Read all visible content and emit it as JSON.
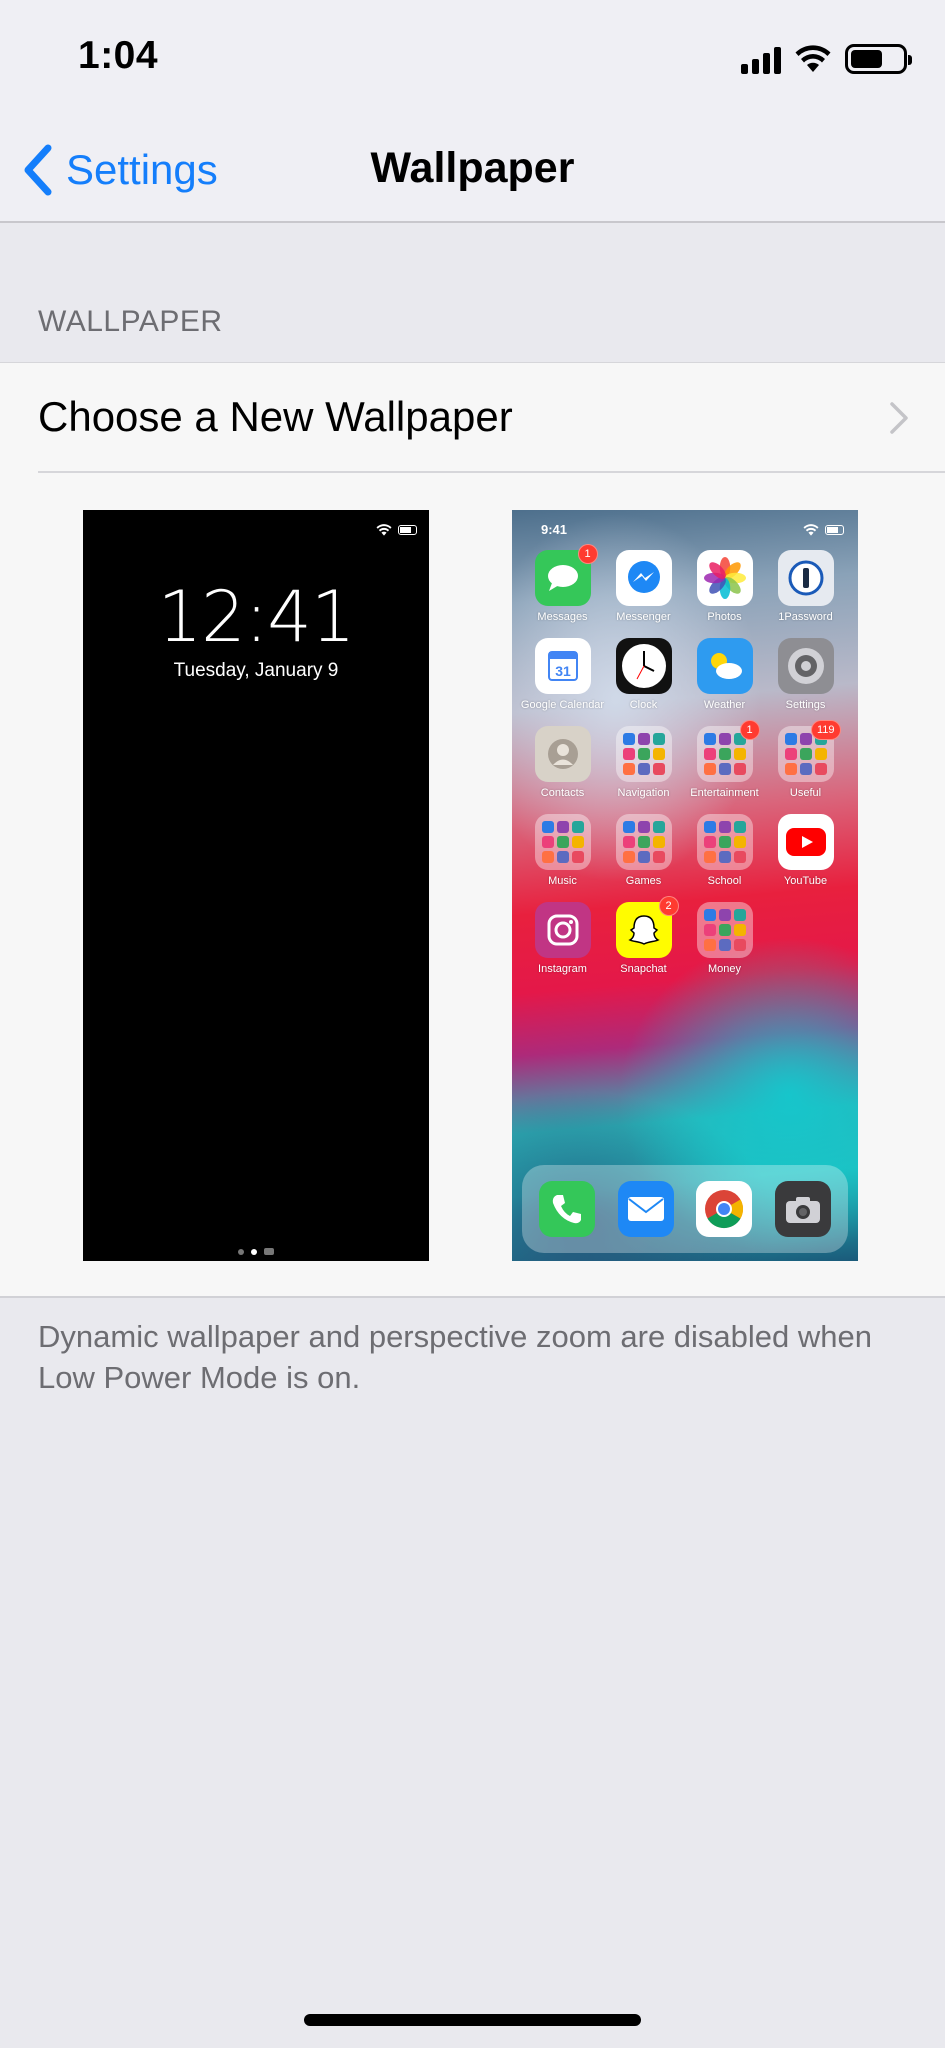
{
  "status_bar": {
    "time": "1:04",
    "battery_level": 0.62
  },
  "nav": {
    "back_label": "Settings",
    "title": "Wallpaper"
  },
  "section": {
    "header": "WALLPAPER"
  },
  "choose_row": {
    "label": "Choose a New Wallpaper"
  },
  "lock_preview": {
    "time": "12:41",
    "date": "Tuesday, January 9"
  },
  "home_preview": {
    "time": "9:41",
    "apps": [
      {
        "label": "Messages",
        "icon": "messages-icon",
        "color": "#35c759",
        "badge": "1"
      },
      {
        "label": "Messenger",
        "icon": "messenger-icon",
        "color": "#ffffff",
        "badge": ""
      },
      {
        "label": "Photos",
        "icon": "photos-icon",
        "color": "#ffffff",
        "badge": ""
      },
      {
        "label": "1Password",
        "icon": "onepassword-icon",
        "color": "#e6eaf0",
        "badge": ""
      },
      {
        "label": "Google Calendar",
        "icon": "google-calendar-icon",
        "color": "#ffffff",
        "badge": ""
      },
      {
        "label": "Clock",
        "icon": "clock-icon",
        "color": "#111111",
        "badge": ""
      },
      {
        "label": "Weather",
        "icon": "weather-icon",
        "color": "#2e9bf0",
        "badge": ""
      },
      {
        "label": "Settings",
        "icon": "settings-icon",
        "color": "#8e8e93",
        "badge": ""
      },
      {
        "label": "Contacts",
        "icon": "contacts-icon",
        "color": "#d8d2c8",
        "badge": ""
      },
      {
        "label": "Navigation",
        "icon": "folder-icon",
        "color": "folder",
        "badge": ""
      },
      {
        "label": "Entertainment",
        "icon": "folder-icon",
        "color": "folder",
        "badge": "1"
      },
      {
        "label": "Useful",
        "icon": "folder-icon",
        "color": "folder",
        "badge": "119"
      },
      {
        "label": "Music",
        "icon": "folder-icon",
        "color": "folder",
        "badge": ""
      },
      {
        "label": "Games",
        "icon": "folder-icon",
        "color": "folder",
        "badge": ""
      },
      {
        "label": "School",
        "icon": "folder-icon",
        "color": "folder",
        "badge": ""
      },
      {
        "label": "YouTube",
        "icon": "youtube-icon",
        "color": "#ffffff",
        "badge": ""
      },
      {
        "label": "Instagram",
        "icon": "instagram-icon",
        "color": "#c13584",
        "badge": ""
      },
      {
        "label": "Snapchat",
        "icon": "snapchat-icon",
        "color": "#fffc00",
        "badge": "2"
      },
      {
        "label": "Money",
        "icon": "folder-icon",
        "color": "folder",
        "badge": ""
      }
    ],
    "dock": [
      {
        "icon": "phone-icon",
        "color": "#34c759"
      },
      {
        "icon": "mail-icon",
        "color": "#1e88f5"
      },
      {
        "icon": "chrome-icon",
        "color": "#ffffff"
      },
      {
        "icon": "camera-icon",
        "color": "#3a3a3c"
      }
    ]
  },
  "footer": {
    "note": "Dynamic wallpaper and perspective zoom are disabled when Low Power Mode is on."
  },
  "colors": {
    "accent": "#147efb",
    "background": "#e9e9ee",
    "cell": "#f7f7f7",
    "secondary_text": "#6d6d72"
  }
}
